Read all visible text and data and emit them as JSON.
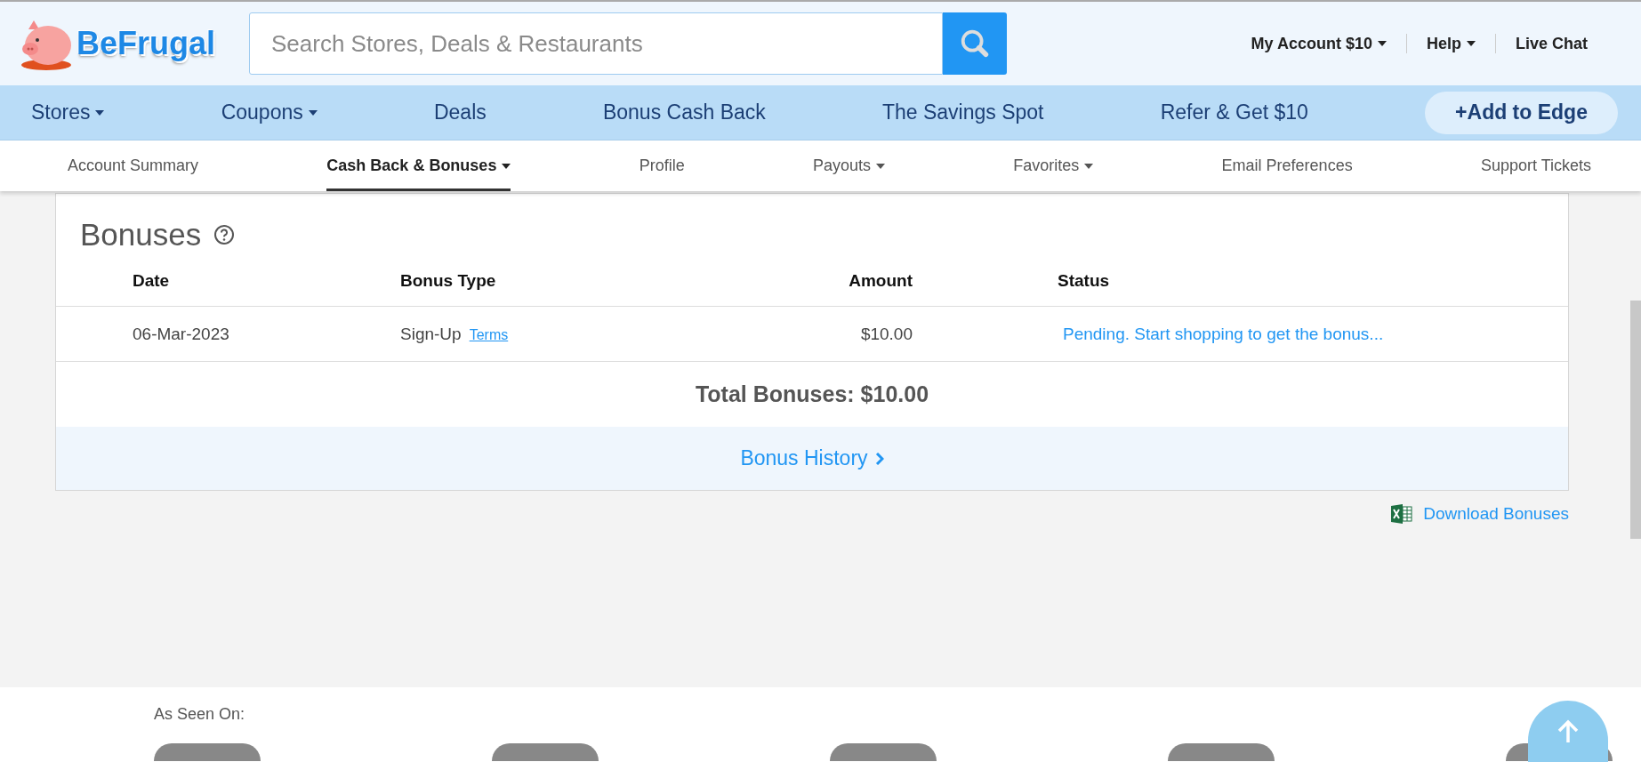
{
  "logo": {
    "text": "BeFrugal"
  },
  "search": {
    "placeholder": "Search Stores, Deals & Restaurants"
  },
  "account_links": [
    {
      "label": "My Account $10",
      "dropdown": true
    },
    {
      "label": "Help",
      "dropdown": true
    },
    {
      "label": "Live Chat",
      "dropdown": false
    }
  ],
  "main_nav": [
    {
      "label": "Stores",
      "dropdown": true
    },
    {
      "label": "Coupons",
      "dropdown": true
    },
    {
      "label": "Deals",
      "dropdown": false
    },
    {
      "label": "Bonus Cash Back",
      "dropdown": false
    },
    {
      "label": "The Savings Spot",
      "dropdown": false
    },
    {
      "label": "Refer & Get $10",
      "dropdown": false
    }
  ],
  "add_button": "+Add to Edge",
  "sub_nav": [
    {
      "label": "Account Summary",
      "dropdown": false,
      "selected": false
    },
    {
      "label": "Cash Back & Bonuses",
      "dropdown": true,
      "selected": true
    },
    {
      "label": "Profile",
      "dropdown": false,
      "selected": false
    },
    {
      "label": "Payouts",
      "dropdown": true,
      "selected": false
    },
    {
      "label": "Favorites",
      "dropdown": true,
      "selected": false
    },
    {
      "label": "Email Preferences",
      "dropdown": false,
      "selected": false
    },
    {
      "label": "Support Tickets",
      "dropdown": false,
      "selected": false
    }
  ],
  "bonuses": {
    "title": "Bonuses",
    "columns": [
      "Date",
      "Bonus Type",
      "Amount",
      "Status"
    ],
    "rows": [
      {
        "date": "06-Mar-2023",
        "type": "Sign-Up",
        "terms_link": "Terms",
        "amount": "$10.00",
        "status": "Pending. Start shopping to get the bonus..."
      }
    ],
    "total": "Total Bonuses: $10.00",
    "history_link": "Bonus History"
  },
  "download_link": "Download Bonuses",
  "footer": {
    "heading": "As Seen On:"
  }
}
